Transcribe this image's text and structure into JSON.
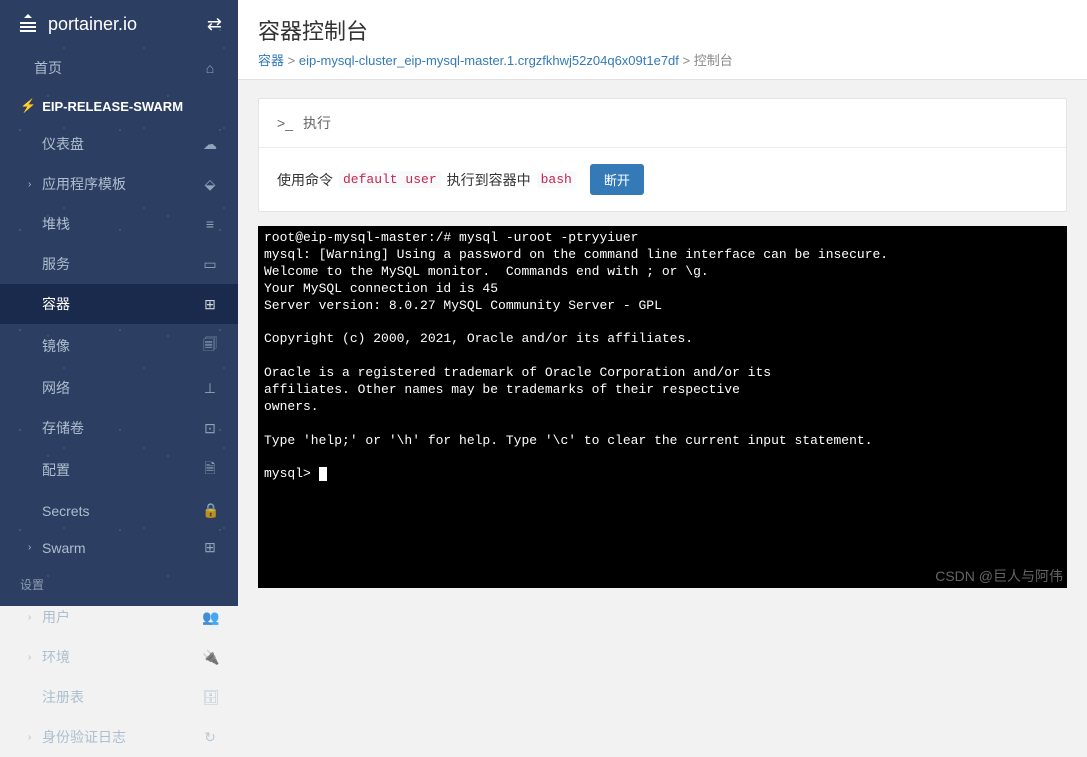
{
  "brand": "portainer.io",
  "sidebar": {
    "home": "首页",
    "env": "EIP-RELEASE-SWARM",
    "items": [
      {
        "label": "仪表盘",
        "icon": "☁"
      },
      {
        "label": "应用程序模板",
        "icon": "⬙",
        "hasChildren": true
      },
      {
        "label": "堆栈",
        "icon": "≡"
      },
      {
        "label": "服务",
        "icon": "▭"
      },
      {
        "label": "容器",
        "icon": "⊞",
        "active": true
      },
      {
        "label": "镜像",
        "icon": "🗐"
      },
      {
        "label": "网络",
        "icon": "⊥"
      },
      {
        "label": "存储卷",
        "icon": "⊡"
      },
      {
        "label": "配置",
        "icon": "🗎"
      },
      {
        "label": "Secrets",
        "icon": "🔒"
      },
      {
        "label": "Swarm",
        "icon": "⊞",
        "hasChildren": true
      }
    ],
    "settings_label": "设置",
    "settings": [
      {
        "label": "用户",
        "icon": "👥",
        "hasChildren": true
      },
      {
        "label": "环境",
        "icon": "🔌",
        "hasChildren": true
      },
      {
        "label": "注册表",
        "icon": "🗄"
      },
      {
        "label": "身份验证日志",
        "icon": "↻",
        "hasChildren": true
      }
    ]
  },
  "header": {
    "title": "容器控制台",
    "crumb1": "容器",
    "crumb2": "eip-mysql-cluster_eip-mysql-master.1.crgzfkhwj52z04q6x09t1e7df",
    "crumb3": "控制台",
    "sep": " > "
  },
  "exec": {
    "header": "执行",
    "text1": "使用命令 ",
    "user": "default user",
    "text2": " 执行到容器中 ",
    "shell": "bash",
    "disconnect": "断开"
  },
  "terminal": "root@eip-mysql-master:/# mysql -uroot -ptryyiuer\nmysql: [Warning] Using a password on the command line interface can be insecure.\nWelcome to the MySQL monitor.  Commands end with ; or \\g.\nYour MySQL connection id is 45\nServer version: 8.0.27 MySQL Community Server - GPL\n\nCopyright (c) 2000, 2021, Oracle and/or its affiliates.\n\nOracle is a registered trademark of Oracle Corporation and/or its\naffiliates. Other names may be trademarks of their respective\nowners.\n\nType 'help;' or '\\h' for help. Type '\\c' to clear the current input statement.\n\nmysql> ",
  "watermark": "CSDN @巨人与阿伟"
}
